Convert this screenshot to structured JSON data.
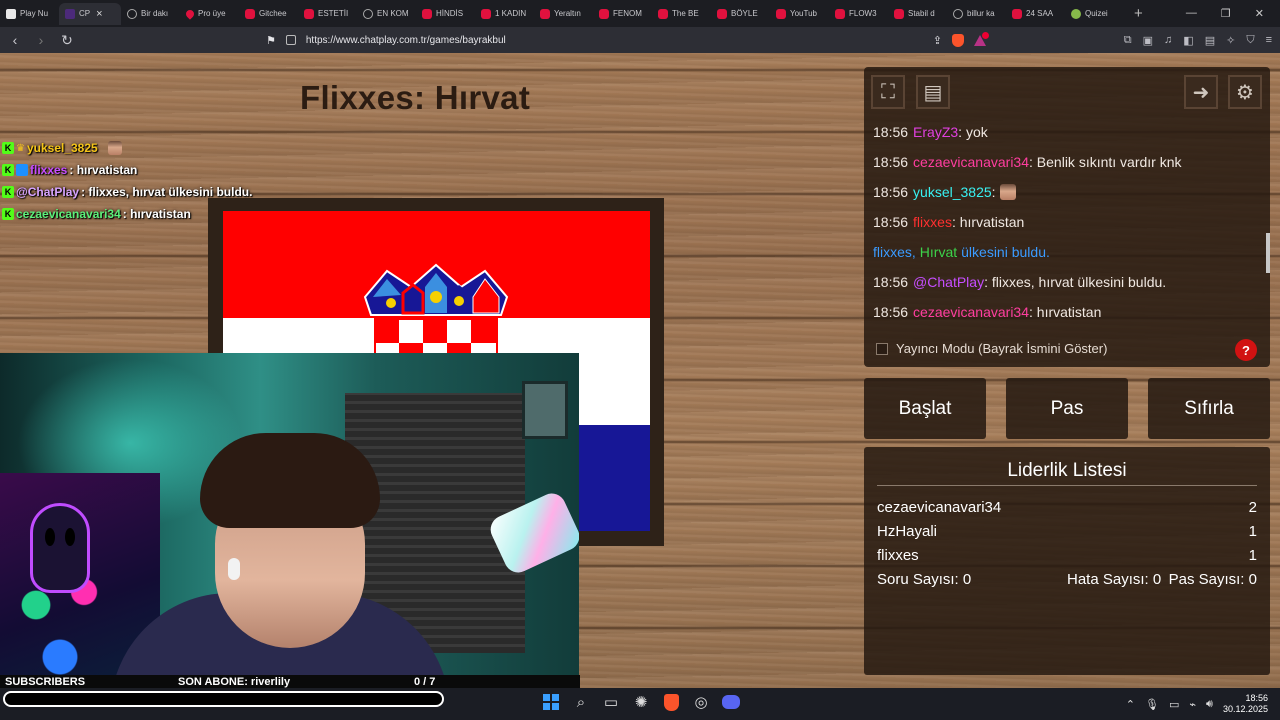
{
  "browser": {
    "tabs": [
      {
        "label": "Play Nu",
        "icon": "play",
        "active": false
      },
      {
        "label": "CP",
        "icon": "cp",
        "active": true
      },
      {
        "label": "Bir dakı",
        "icon": "web",
        "active": false
      },
      {
        "label": "Pro üye",
        "icon": "pin",
        "active": false
      },
      {
        "label": "Gitchee",
        "icon": "yt",
        "active": false
      },
      {
        "label": "ESTETİI",
        "icon": "yt",
        "active": false
      },
      {
        "label": "EN KOM",
        "icon": "web",
        "active": false
      },
      {
        "label": "HİNDİS",
        "icon": "yt",
        "active": false
      },
      {
        "label": "1 KADIN",
        "icon": "yt",
        "active": false
      },
      {
        "label": "Yeraltın",
        "icon": "yt",
        "active": false
      },
      {
        "label": "FENOM",
        "icon": "yt",
        "active": false
      },
      {
        "label": "The BE",
        "icon": "yt",
        "active": false
      },
      {
        "label": "BÖYLE",
        "icon": "yt",
        "active": false
      },
      {
        "label": "YouTub",
        "icon": "yt",
        "active": false
      },
      {
        "label": "FLOW3",
        "icon": "yt",
        "active": false
      },
      {
        "label": "Stabil d",
        "icon": "yt",
        "active": false
      },
      {
        "label": "billur ka",
        "icon": "web",
        "active": false
      },
      {
        "label": "24 SAA",
        "icon": "yt",
        "active": false
      },
      {
        "label": "Quizei",
        "icon": "quiz",
        "active": false
      }
    ],
    "url": "https://www.chatplay.com.tr/games/bayrakbul",
    "brave_badge": "1"
  },
  "game": {
    "title": "Flixxes: Hırvat"
  },
  "overlay_chat": [
    {
      "user": "yuksel_3825",
      "user_color": "#f5c518",
      "text": "",
      "emote": true
    },
    {
      "user": "flixxes",
      "user_color": "#c64dff",
      "text": ": hırvatistan",
      "emote": false
    },
    {
      "user": "@ChatPlay",
      "user_color": "#d7a3ff",
      "text": ": flixxes, hırvat ülkesini buldu.",
      "emote": false
    },
    {
      "user": "cezaevicanavari34",
      "user_color": "#5cf07a",
      "text": " : hırvatistan",
      "emote": false
    }
  ],
  "chat": {
    "messages": [
      {
        "time": "18:56",
        "user": "ErayZ3",
        "user_class": "u-magenta",
        "text": ": yok"
      },
      {
        "time": "18:56",
        "user": "cezaevicanavari34",
        "user_class": "u-pink",
        "text": ": Benlik sıkıntı vardır knk"
      },
      {
        "time": "18:56",
        "user": "yuksel_3825",
        "user_class": "u-cyan",
        "text": ":"
      },
      {
        "time": "18:56",
        "user": "flixxes",
        "user_class": "u-red",
        "text": ": hırvatistan"
      },
      {
        "time": "18:56",
        "user": "@ChatPlay",
        "user_class": "u-purple",
        "text": ": flixxes, hırvat ülkesini buldu."
      },
      {
        "time": "18:56",
        "user": "cezaevicanavari34",
        "user_class": "u-pink",
        "text": ": hırvatistan"
      }
    ],
    "system_line": {
      "a": "flixxes,",
      "b": "Hırvat",
      "c": "ülkesini buldu."
    },
    "streamer_mode_label": "Yayıncı Modu (Bayrak İsmini Göster)",
    "help_label": "?"
  },
  "buttons": {
    "start": "Başlat",
    "pass": "Pas",
    "reset": "Sıfırla"
  },
  "leaderboard": {
    "title": "Liderlik Listesi",
    "rows": [
      {
        "name": "cezaevicanavari34",
        "score": "2"
      },
      {
        "name": "HzHayali",
        "score": "1"
      },
      {
        "name": "flixxes",
        "score": "1"
      }
    ],
    "question_count_label": "Soru Sayısı:",
    "question_count": "0",
    "error_count_label": "Hata Sayısı:",
    "error_count": "0",
    "pass_count_label": "Pas Sayısı:",
    "pass_count": "0"
  },
  "stream_overlay": {
    "subscribers_label": "SUBSCRIBERS",
    "last_sub_label": "SON ABONE: riverlily",
    "sub_progress": "0 / 7"
  },
  "taskbar": {
    "time": "18:56",
    "date": "30.12.2025"
  }
}
